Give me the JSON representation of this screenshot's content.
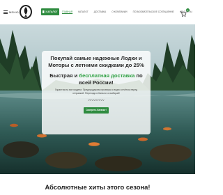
{
  "header": {
    "menu_label": "МЕНЮ",
    "catalog_label": "КАТАЛОГ",
    "nav": [
      {
        "label": "ГЛАВНАЯ"
      },
      {
        "label": "КАТАЛОГ"
      },
      {
        "label": "ДОСТАВКА"
      },
      {
        "label": "О КОМПАНИИ"
      },
      {
        "label": "ПОЛЬЗОВАТЕЛЬСКОЕ СОГЛАШЕНИЕ"
      },
      {
        "label": "КОНТАКТЫ"
      }
    ],
    "cart_count": "0",
    "accent_color": "#2e8b3f"
  },
  "hero": {
    "title": "Покупай самые надежные Лодки и Моторы с летними скидками до 25%",
    "subtitle_start": "Быстрая и ",
    "subtitle_highlight": "бесплатная доставка",
    "subtitle_end": " по всей России!",
    "text": "Гарантия на все модели. Предпродажная проверка с видео отчётом перед отправкой. Переходи в Каталог и выбирай!",
    "code": "VVVVVVVVV",
    "button_label": "Смотреть Каталог!"
  },
  "section": {
    "title": "Абсолютные хиты этого сезона!"
  },
  "icons": {
    "menu": "burger-icon",
    "logo": "fish-logo-icon",
    "catalog": "grid-icon",
    "cart": "cart-icon"
  }
}
